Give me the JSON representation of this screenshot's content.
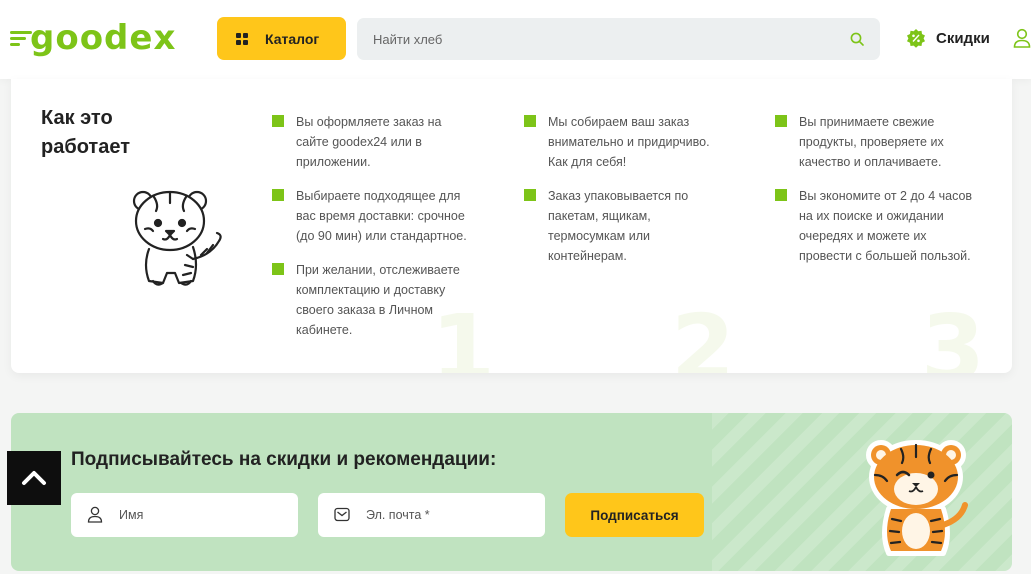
{
  "header": {
    "logo_text": "goodex",
    "catalog_label": "Каталог",
    "search_placeholder": "Найти хлеб",
    "discounts_label": "Скидки"
  },
  "colors": {
    "brand_green": "#7dc418",
    "accent_yellow": "#ffc61a",
    "subscribe_bg": "#c0e3c0"
  },
  "how_it_works": {
    "title": "Как это работает",
    "columns": [
      {
        "number": "1",
        "steps": [
          "Вы оформляете заказ на сайте goodex24 или в приложении.",
          "Выбираете подходящее для вас время доставки: срочное (до 90 мин) или стандартное.",
          "При желании, отслеживаете комплектацию и доставку своего заказа в Личном кабинете."
        ]
      },
      {
        "number": "2",
        "steps": [
          "Мы собираем ваш заказ внимательно и придирчиво. Как для себя!",
          "Заказ упаковывается по пакетам, ящикам, термосумкам или контейнерам."
        ]
      },
      {
        "number": "3",
        "steps": [
          "Вы принимаете свежие продукты, проверяете их качество и оплачиваете.",
          "Вы экономите от 2 до 4 часов на их поиске и ожидании очередях и можете их провести с большей пользой."
        ]
      }
    ]
  },
  "subscribe": {
    "title": "Подписывайтесь на скидки и рекомендации:",
    "name_placeholder": "Имя",
    "email_placeholder": "Эл. почта *",
    "button_label": "Подписаться"
  },
  "icons": {
    "catalog": "grid-icon",
    "search": "search-icon",
    "discount": "discount-badge-icon",
    "user": "user-icon",
    "name_field": "user-icon",
    "email_field": "envelope-icon",
    "scroll_top": "chevron-up-icon"
  }
}
